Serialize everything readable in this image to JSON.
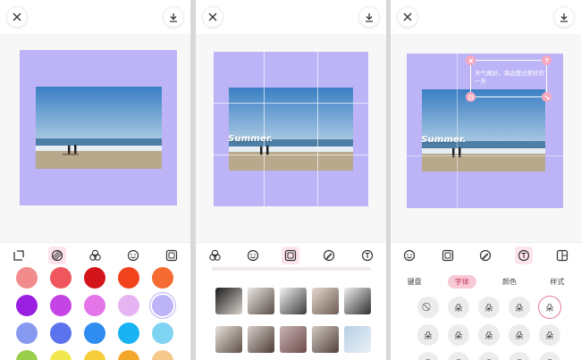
{
  "screens": [
    {
      "id": "color-panel",
      "toolbar_icons": [
        "crop-icon",
        "background-color-icon",
        "filter-icon",
        "sticker-icon",
        "frame-icon"
      ],
      "active_tool": "background-color-icon",
      "swatches": [
        [
          "#f28b8b",
          "#f0565e",
          "#d3151b",
          "#f2421c",
          "#f46c31"
        ],
        [
          "#9a1fe0",
          "#c444e6",
          "#e475e9",
          "#e6b4f2",
          "#bcb4f7"
        ],
        [
          "#8899f0",
          "#5b74ee",
          "#2f8cf0",
          "#19b3f3",
          "#7ed4f2"
        ],
        [
          "#9acd4a",
          "#f0e84e",
          "#f6cc3a",
          "#f2a72a",
          "#f5c98a"
        ]
      ],
      "selected_swatch": "#bcb4f7"
    },
    {
      "id": "frame-panel",
      "overlay_text": "Summer.",
      "toolbar_icons": [
        "filter-icon",
        "sticker-icon",
        "frame-icon",
        "edit-icon",
        "text-icon"
      ],
      "active_tool": "frame-icon"
    },
    {
      "id": "text-panel",
      "overlay_text": "Summer.",
      "textbox_text": "天气真好，海边度过美好的一天",
      "toolbar_icons": [
        "sticker-icon",
        "frame-icon",
        "edit-icon",
        "text-icon",
        "layout-icon"
      ],
      "active_tool": "text-icon",
      "tabs": [
        "键盘",
        "字体",
        "颜色",
        "样式"
      ],
      "active_tab": "字体",
      "font_glyphs": [
        [
          "⃠",
          "朵",
          "朵",
          "朵",
          "朵"
        ],
        [
          "朵",
          "朵",
          "朵",
          "朵",
          "朵"
        ],
        [
          "朵",
          "朵",
          "朵",
          "朵",
          "朵"
        ]
      ]
    }
  ]
}
